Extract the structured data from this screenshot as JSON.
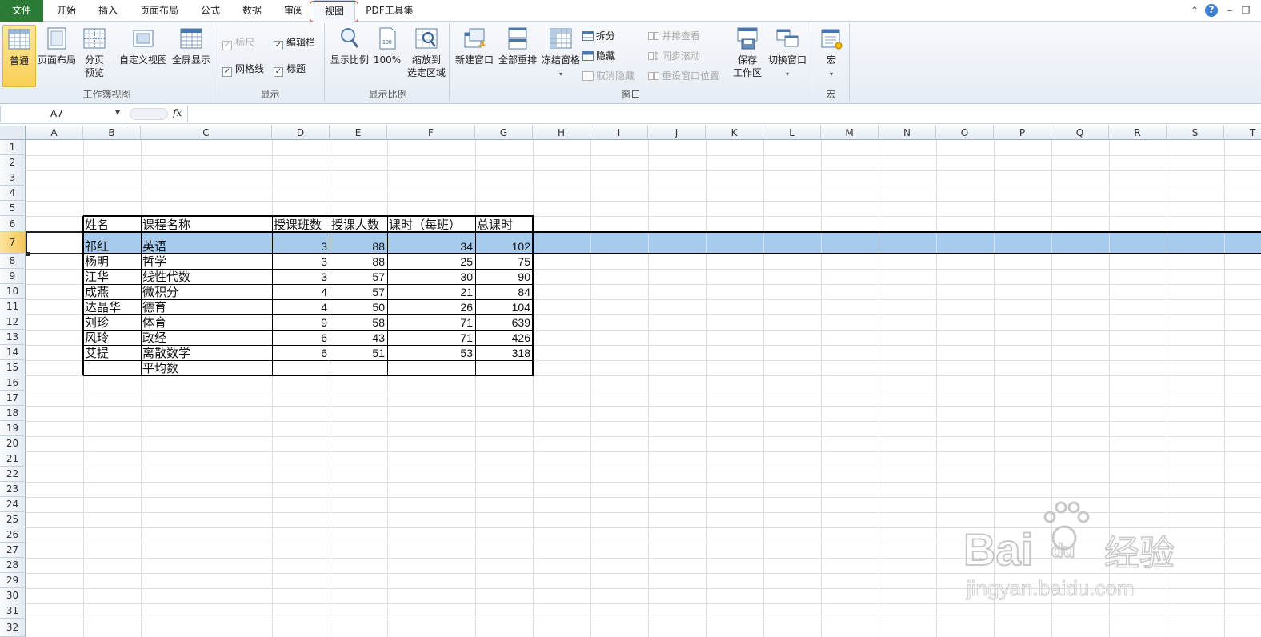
{
  "tabs": {
    "file": "文件",
    "items": [
      "开始",
      "插入",
      "页面布局",
      "公式",
      "数据",
      "审阅",
      "视图",
      "PDF工具集"
    ],
    "active": "视图"
  },
  "ribbon": {
    "workbook_views": {
      "label": "工作簿视图",
      "normal": "普通",
      "page_layout": "页面布局",
      "page_break_line1": "分页",
      "page_break_line2": "预览",
      "custom_views": "自定义视图",
      "full_screen": "全屏显示"
    },
    "show": {
      "label": "显示",
      "ruler": "标尺",
      "formula_bar": "编辑栏",
      "gridlines": "网格线",
      "headings": "标题"
    },
    "zoom": {
      "label": "显示比例",
      "zoom": "显示比例",
      "hundred": "100%",
      "zoom_sel_line1": "缩放到",
      "zoom_sel_line2": "选定区域"
    },
    "window": {
      "label": "窗口",
      "new_window": "新建窗口",
      "arrange_all": "全部重排",
      "freeze": "冻结窗格",
      "split": "拆分",
      "hide": "隐藏",
      "unhide": "取消隐藏",
      "side_by_side": "并排查看",
      "sync_scroll": "同步滚动",
      "reset_pos": "重设窗口位置",
      "save_ws_line1": "保存",
      "save_ws_line2": "工作区",
      "switch": "切换窗口"
    },
    "macros": {
      "label": "宏",
      "macros": "宏"
    }
  },
  "formula_bar": {
    "name_box": "A7",
    "fx": "fx",
    "value": ""
  },
  "columns": [
    "A",
    "B",
    "C",
    "D",
    "E",
    "F",
    "G",
    "H",
    "I",
    "J",
    "K",
    "L",
    "M",
    "N",
    "O",
    "P",
    "Q",
    "R",
    "S",
    "T"
  ],
  "rows": [
    "1",
    "2",
    "3",
    "4",
    "5",
    "6",
    "7",
    "8",
    "9",
    "10",
    "11",
    "12",
    "13",
    "14",
    "15",
    "16",
    "17",
    "18",
    "19",
    "20",
    "21",
    "22",
    "23",
    "24",
    "25",
    "26",
    "27",
    "28",
    "29",
    "30",
    "31",
    "32"
  ],
  "table": {
    "headers": [
      "姓名",
      "课程名称",
      "授课班数",
      "授课人数",
      "课时（每班）",
      "总课时"
    ],
    "rows": [
      [
        "祁红",
        "英语",
        "3",
        "88",
        "34",
        "102"
      ],
      [
        "杨明",
        "哲学",
        "3",
        "88",
        "25",
        "75"
      ],
      [
        "江华",
        "线性代数",
        "3",
        "57",
        "30",
        "90"
      ],
      [
        "成燕",
        "微积分",
        "4",
        "57",
        "21",
        "84"
      ],
      [
        "达晶华",
        "德育",
        "4",
        "50",
        "26",
        "104"
      ],
      [
        "刘珍",
        "体育",
        "9",
        "58",
        "71",
        "639"
      ],
      [
        "风玲",
        "政经",
        "6",
        "43",
        "71",
        "426"
      ],
      [
        "艾提",
        "离散数学",
        "6",
        "51",
        "53",
        "318"
      ],
      [
        "",
        "平均数",
        "",
        "",
        "",
        ""
      ]
    ]
  },
  "watermark": {
    "brand": "Bai",
    "brand2": "du",
    "cn": "经验",
    "url": "jingyan.baidu.com"
  },
  "colors": {
    "file_tab": "#2b7a35",
    "selection": "#a6cbee",
    "header_selected": "#f6c85a",
    "red_highlight": "#e02020"
  }
}
